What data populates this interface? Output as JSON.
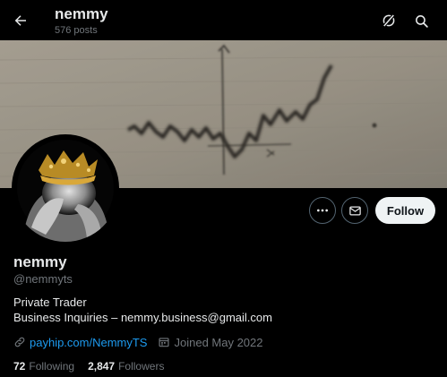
{
  "header": {
    "title": "nemmy",
    "posts_count": "576 posts"
  },
  "profile": {
    "name": "nemmy",
    "handle": "@nemmyts",
    "bio_line1": "Private Trader",
    "bio_line2": "Business Inquiries  – nemmy.business@gmail.com",
    "link": "payhip.com/NemmyTS",
    "joined": "Joined May 2022"
  },
  "actions": {
    "follow_label": "Follow"
  },
  "stats": {
    "following_count": "72",
    "following_label": "Following",
    "followers_count": "2,847",
    "followers_label": "Followers"
  },
  "icons": {
    "back": "arrow-left-icon",
    "grok": "grok-icon",
    "search": "search-icon",
    "more": "more-icon",
    "message": "envelope-icon",
    "link": "link-icon",
    "calendar": "calendar-icon"
  },
  "colors": {
    "background": "#000000",
    "accent": "#1d9bf0",
    "text": "#e7e9ea",
    "muted": "#71767b",
    "follow_bg": "#eff3f4"
  }
}
